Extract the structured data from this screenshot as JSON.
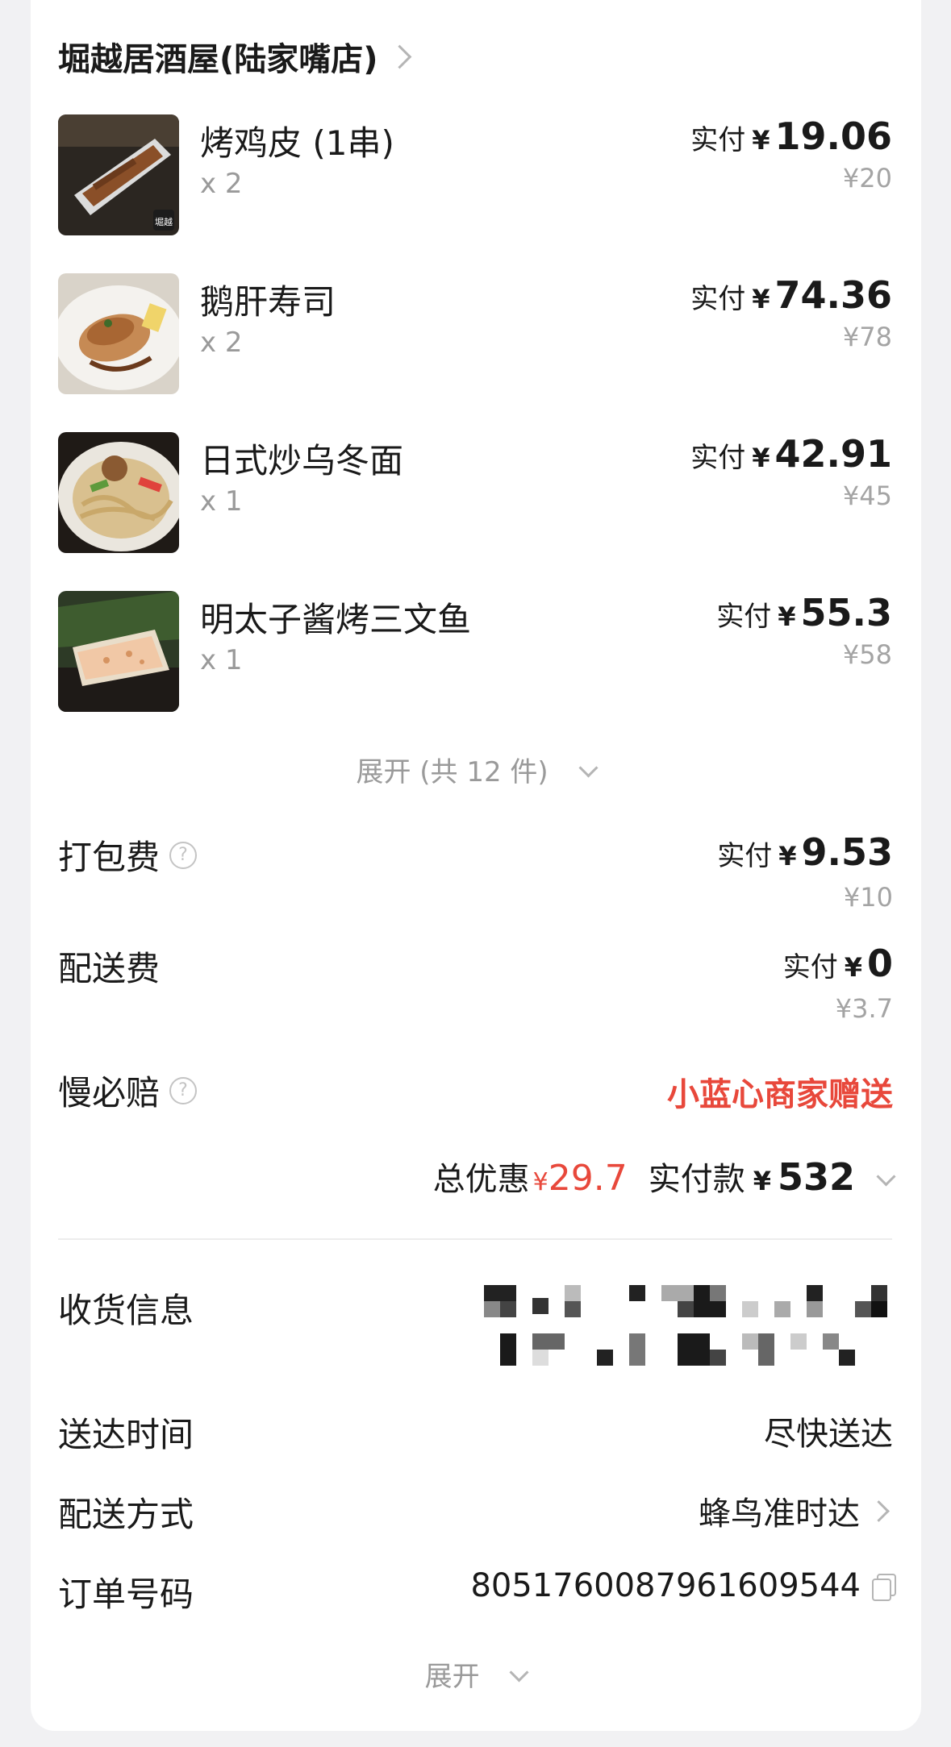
{
  "store": {
    "name": "堀越居酒屋(陆家嘴店)",
    "thumb_badge": "堀越"
  },
  "items": [
    {
      "name": "烤鸡皮 (1串)",
      "qty": "x 2",
      "paid_label": "实付",
      "currency": "¥",
      "paid": "19.06",
      "original": "¥20"
    },
    {
      "name": "鹅肝寿司",
      "qty": "x 2",
      "paid_label": "实付",
      "currency": "¥",
      "paid": "74.36",
      "original": "¥78"
    },
    {
      "name": "日式炒乌冬面",
      "qty": "x 1",
      "paid_label": "实付",
      "currency": "¥",
      "paid": "42.91",
      "original": "¥45"
    },
    {
      "name": "明太子酱烤三文鱼",
      "qty": "x 1",
      "paid_label": "实付",
      "currency": "¥",
      "paid": "55.3",
      "original": "¥58"
    }
  ],
  "expand_items_label": "展开 (共 12 件)",
  "fees": {
    "packaging": {
      "label": "打包费",
      "paid_label": "实付",
      "currency": "¥",
      "paid": "9.53",
      "original": "¥10"
    },
    "delivery": {
      "label": "配送费",
      "paid_label": "实付",
      "currency": "¥",
      "paid": "0",
      "original": "¥3.7"
    },
    "late_compensation": {
      "label": "慢必赔",
      "value": "小蓝心商家赠送"
    }
  },
  "summary": {
    "discount_label": "总优惠",
    "discount_currency": "¥",
    "discount_value": "29.7",
    "paid_label": "实付款",
    "paid_currency": "¥",
    "paid_value": "532"
  },
  "info": {
    "receiver_label": "收货信息",
    "delivery_time_label": "送达时间",
    "delivery_time_value": "尽快送达",
    "delivery_method_label": "配送方式",
    "delivery_method_value": "蜂鸟准时达",
    "order_no_label": "订单号码",
    "order_no_value": "8051760087961609544"
  },
  "expand_info_label": "展开",
  "colors": {
    "discount_red": "#e8483b",
    "text": "#1a1a1a",
    "muted": "#9a9a9a",
    "background": "#f1f1f3"
  }
}
